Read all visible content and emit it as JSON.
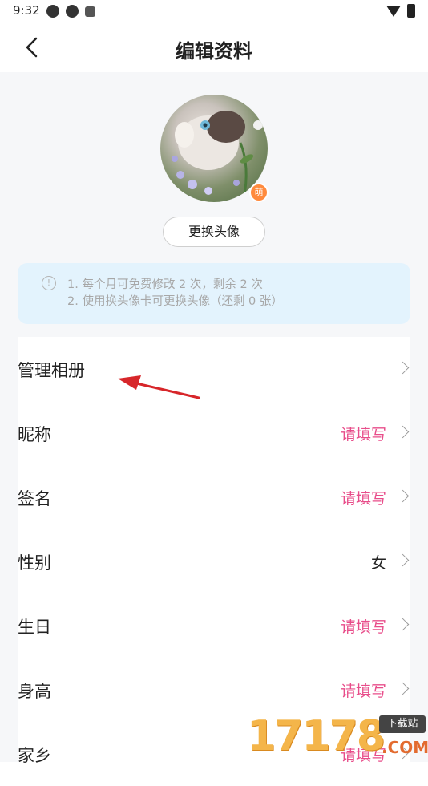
{
  "status_bar": {
    "time": "9:32"
  },
  "nav": {
    "title": "编辑资料"
  },
  "avatar": {
    "badge": "萌",
    "change_button": "更换头像"
  },
  "notice": {
    "line1": "1. 每个月可免费修改 2 次，剩余 2 次",
    "line2": "2. 使用换头像卡可更换头像（还剩 0 张）"
  },
  "rows": [
    {
      "label": "管理相册",
      "value": ""
    },
    {
      "label": "昵称",
      "value": "请填写"
    },
    {
      "label": "签名",
      "value": "请填写"
    },
    {
      "label": "性别",
      "value": "女"
    },
    {
      "label": "生日",
      "value": "请填写"
    },
    {
      "label": "身高",
      "value": "请填写"
    },
    {
      "label": "家乡",
      "value": "请填写"
    }
  ],
  "watermark": {
    "number": "17178",
    "tag": "下载站",
    "domain": ".COM"
  },
  "colors": {
    "accent": "#e84d8a",
    "annotation_arrow": "#d7262a",
    "notice_bg": "#e3f3fd"
  }
}
